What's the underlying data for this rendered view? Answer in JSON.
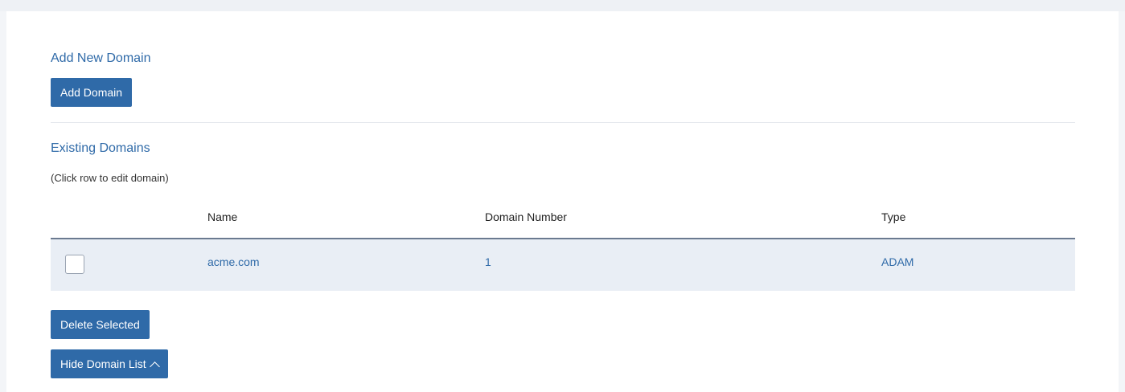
{
  "add_section": {
    "title": "Add New Domain",
    "add_button_label": "Add Domain"
  },
  "existing_section": {
    "title": "Existing Domains",
    "hint": "(Click row to edit domain)"
  },
  "table": {
    "columns": [
      "Name",
      "Domain Number",
      "Type"
    ],
    "rows": [
      {
        "checked": false,
        "name": "acme.com",
        "domain_number": "1",
        "type": "ADAM"
      }
    ]
  },
  "actions": {
    "delete_label": "Delete Selected",
    "hide_list_label": "Hide Domain List",
    "hide_list_icon": "chevron-up-icon"
  },
  "colors": {
    "accent": "#2f6aa8",
    "row_background": "#e9eef5"
  }
}
